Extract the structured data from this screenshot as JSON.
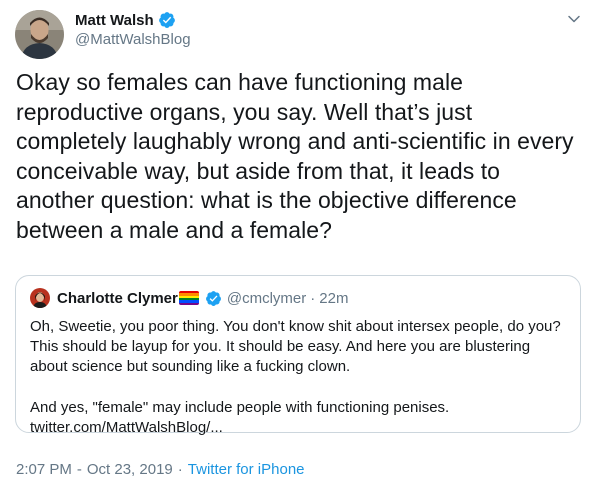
{
  "author": {
    "name": "Matt Walsh",
    "handle": "@MattWalshBlog"
  },
  "tweet": {
    "text": "Okay so females can have functioning male reproductive organs, you say. Well that’s just completely laughably wrong and anti-scientific in every conceivable way, but aside from that, it leads to another question: what is the objective difference between a male and a female?",
    "time": "2:07 PM",
    "date": "Oct 23, 2019",
    "separator": "·",
    "source": "Twitter for iPhone"
  },
  "quoted": {
    "name": "Charlotte Clymer",
    "handle": "@cmclymer",
    "separator": "·",
    "time": "22m",
    "paragraph1": "Oh, Sweetie, you poor thing. You don't know shit about intersex people, do you? This should be layup for you. It should be easy. And here you are blustering about science but sounding like a fucking clown.",
    "paragraph2": "And yes, \"female\" may include people with functioning penises. twitter.com/MattWalshBlog/..."
  },
  "colors": {
    "verified": "#1da1f2",
    "link": "#1b95e0",
    "secondary_text": "#657786",
    "border": "#ccd6dd"
  },
  "icons": {
    "verified": "verified-badge-icon",
    "menu": "chevron-down-icon",
    "flag": "rainbow-flag-emoji"
  }
}
